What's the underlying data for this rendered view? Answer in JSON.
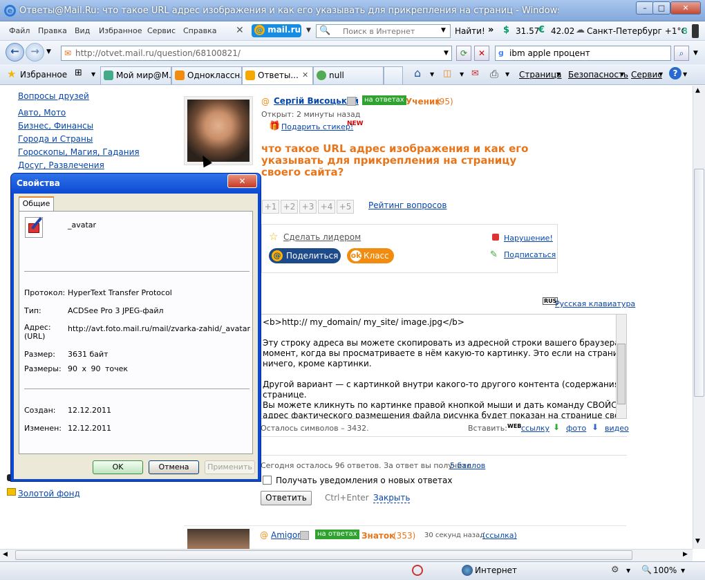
{
  "window": {
    "title": "Ответы@Mail.Ru: что такое URL адрес изображения и как его указывать для прикрепления на страниц - Windows Internet Explorer"
  },
  "menubar": {
    "items": [
      "Файл",
      "Правка",
      "Вид",
      "Избранное",
      "Сервис",
      "Справка"
    ],
    "mailru_logo": "mail.ru",
    "search_placeholder": "Поиск в Интернет",
    "search_button": "Найти!",
    "usd": "31.57",
    "eur": "42.02",
    "weather": "Санкт-Петербург +1°C",
    "counter": "8"
  },
  "navbar": {
    "address": "http://otvet.mail.ru/question/68100821/",
    "google_query": "ibm apple процент"
  },
  "tabs": {
    "favorites": "Избранное",
    "items": [
      "Мой мир@М...",
      "Одноклассн...",
      "Ответы...",
      "null"
    ],
    "page": "Страница",
    "security": "Безопасность",
    "service": "Сервис",
    "help": "?"
  },
  "sidebar": {
    "links": [
      "Вопросы друзей",
      "Авто, Мото",
      "Бизнес, Финансы",
      "Города и Страны",
      "Гороскопы, Магия, Гадания",
      "Досуг, Развлечения"
    ],
    "bottom_link": "Золотой фонд"
  },
  "question": {
    "author": "Сергій Висоцький",
    "badge": "на ответах",
    "rank": "Ученик",
    "rank_points": "(95)",
    "opened": "Открыт: 2 минуты назад",
    "gift": "Подарить стикер!",
    "gift_new": "NEW",
    "title": "что такое URL адрес изображения и как его указывать для прикрепления на страницу своего сайта?",
    "ratings": [
      "+1",
      "+2",
      "+3",
      "+4",
      "+5"
    ],
    "rating_link": "Рейтинг вопросов",
    "make_leader": "Сделать лидером",
    "violation": "Нарушение!",
    "share": "Поделиться",
    "klass": "Класс",
    "subscribe": "Подписаться"
  },
  "answer_form": {
    "keyboard": "Русская клавиатура",
    "lines": [
      "<b>http:// my_domain/ my_site/ image.jpg</b>",
      "",
      "Эту строку адреса вы можете скопировать из адресной строки вашего браузера в тот",
      "момент, когда вы просматриваете в нём какую-то картинку. Это если на странице нет",
      "ничего, кроме картинки.",
      "",
      "Другой вариант — с картинкой внутри какого-то другого контента (содержания) на",
      "странице.",
      "Вы можете кликнуть по картинке правой кнопкой мыши и дать команду СВОЙСТВА —",
      "адрес фактического размещения файла рисунка будет показан на странице свойств."
    ],
    "chars_left": "Осталось символов – 3432.",
    "insert": "Вставить:",
    "link": "ссылку",
    "photo": "фото",
    "video": "видео",
    "answers_left_prefix": "Сегодня осталось 96 ответов. За ответ вы получите",
    "points_link": "5 баллов",
    "notify": "Получать уведомления о новых ответах",
    "submit": "Ответить",
    "shortcut": "Ctrl+Enter",
    "close": "Закрыть"
  },
  "next_answer": {
    "author": "Amigor",
    "badge": "на ответах",
    "rank": "Знаток",
    "rank_points": "(353)",
    "time": "30 секунд назад",
    "link_label": "(ссылка)"
  },
  "dialog": {
    "title": "Свойства",
    "tab": "Общие",
    "filename": "_avatar",
    "protocol_label": "Протокол:",
    "protocol": "HyperText Transfer Protocol",
    "type_label": "Тип:",
    "type": "ACDSee Pro 3 JPEG-файл",
    "address_label": "Адрес:",
    "address_label2": "(URL)",
    "address": "http://avt.foto.mail.ru/mail/zvarka-zahid/_avatar",
    "size_label": "Размер:",
    "size": "3631 байт",
    "dims_label": "Размеры:",
    "dims": "90 x 90 точек",
    "created_label": "Создан:",
    "created": "12.12.2011",
    "modified_label": "Изменен:",
    "modified": "12.12.2011",
    "ok": "OK",
    "cancel": "Отмена",
    "apply": "Применить"
  },
  "statusbar": {
    "zone": "Интернет",
    "zoom": "100%"
  }
}
